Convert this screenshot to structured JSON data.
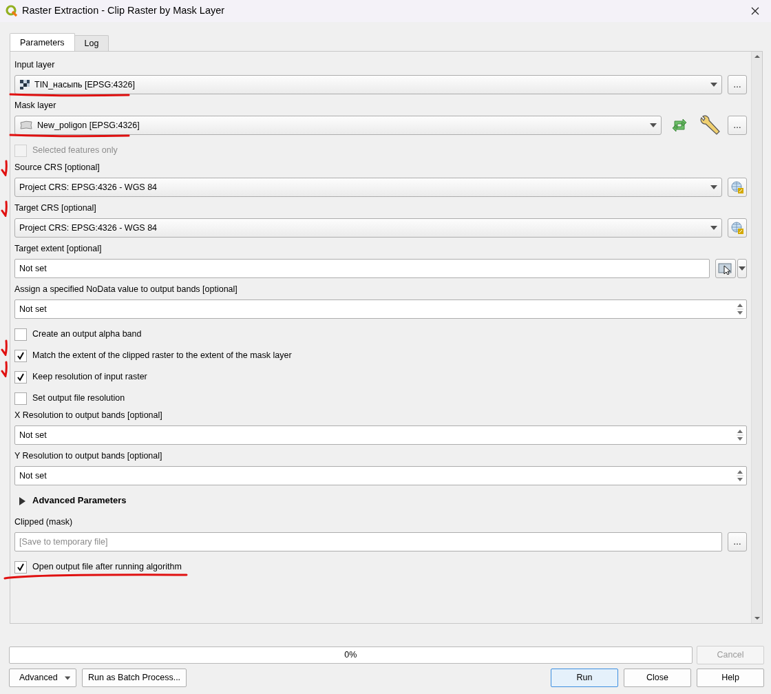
{
  "window": {
    "title": "Raster Extraction - Clip Raster by Mask Layer"
  },
  "tabs": [
    {
      "label": "Parameters",
      "selected": true
    },
    {
      "label": "Log",
      "selected": false
    }
  ],
  "parameters": [
    {
      "kind": "combo",
      "label": "Input layer",
      "value": "TIN_насыпь [EPSG:4326]",
      "layer_icon": {
        "kind": "raster"
      },
      "annotation": {
        "kind": "underline"
      },
      "tools": [
        {
          "kind": "more",
          "text": "…"
        }
      ]
    },
    {
      "kind": "combo",
      "label": "Mask layer",
      "value": "New_poligon [EPSG:4326]",
      "layer_icon": {
        "kind": "polygon"
      },
      "annotation": {
        "kind": "underline"
      },
      "tools": [
        {
          "kind": "iterate"
        },
        {
          "kind": "settings"
        },
        {
          "kind": "menu",
          "text": "…"
        }
      ]
    },
    {
      "kind": "checkbox",
      "label": "Selected features only",
      "checked": false,
      "disabled": true
    },
    {
      "kind": "combo",
      "label": "Source CRS [optional]",
      "value": "Project CRS: EPSG:4326 - WGS 84",
      "annotation": {
        "kind": "tick"
      },
      "tools": [
        {
          "kind": "crs"
        }
      ]
    },
    {
      "kind": "combo",
      "label": "Target CRS [optional]",
      "value": "Project CRS: EPSG:4326 - WGS 84",
      "annotation": {
        "kind": "tick"
      },
      "tools": [
        {
          "kind": "crs"
        }
      ]
    },
    {
      "kind": "text",
      "label": "Target extent [optional]",
      "value": "Not set",
      "tools": [
        {
          "kind": "extent"
        }
      ]
    },
    {
      "kind": "spin",
      "label": "Assign a specified NoData value to output bands [optional]",
      "value": "Not set"
    },
    {
      "kind": "checkbox",
      "label": "Create an output alpha band",
      "checked": false,
      "disabled": false
    },
    {
      "kind": "checkbox",
      "label": "Match the extent of the clipped raster to the extent of the mask layer",
      "checked": true,
      "disabled": false,
      "annotation": {
        "kind": "tick"
      }
    },
    {
      "kind": "checkbox",
      "label": "Keep resolution of input raster",
      "checked": true,
      "disabled": false,
      "annotation": {
        "kind": "tick"
      }
    },
    {
      "kind": "checkbox",
      "label": "Set output file resolution",
      "checked": false,
      "disabled": false
    },
    {
      "kind": "spin",
      "label": "X Resolution to output bands [optional]",
      "value": "Not set"
    },
    {
      "kind": "spin",
      "label": "Y Resolution to output bands [optional]",
      "value": "Not set"
    },
    {
      "kind": "section",
      "label": "Advanced Parameters",
      "expanded": false
    },
    {
      "kind": "file",
      "label": "Clipped (mask)",
      "placeholder": "[Save to temporary file]",
      "tools": [
        {
          "kind": "menu",
          "text": "…"
        }
      ]
    },
    {
      "kind": "checkbox",
      "label": "Open output file after running algorithm",
      "checked": true,
      "disabled": false,
      "annotation": {
        "kind": "underline"
      }
    }
  ],
  "progress": {
    "text": "0%",
    "level": 0
  },
  "buttons": [
    {
      "kind": "cancel",
      "label": "Cancel",
      "disabled": true
    },
    {
      "kind": "dropdown",
      "label": "Advanced",
      "disabled": false
    },
    {
      "kind": "plain",
      "label": "Run as Batch Process...",
      "disabled": false
    },
    {
      "kind": "default",
      "label": "Run",
      "disabled": false
    },
    {
      "kind": "plain",
      "label": "Close",
      "disabled": false
    },
    {
      "kind": "plain",
      "label": "Help",
      "disabled": false
    }
  ]
}
